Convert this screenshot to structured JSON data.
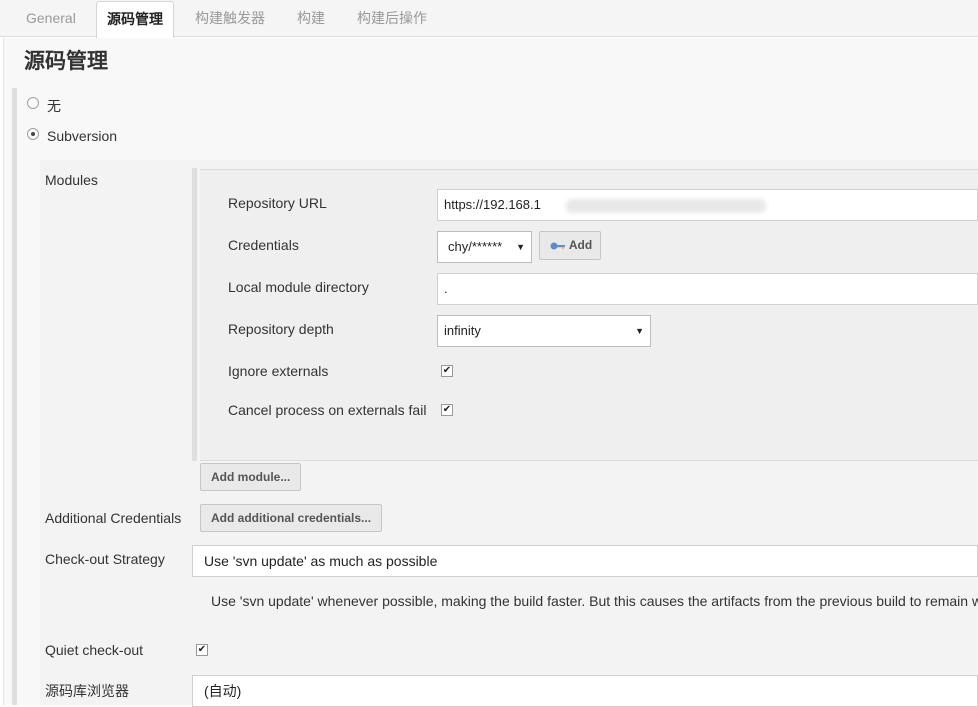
{
  "tabs": [
    {
      "label": "General"
    },
    {
      "label": "源码管理"
    },
    {
      "label": "构建触发器"
    },
    {
      "label": "构建"
    },
    {
      "label": "构建后操作"
    }
  ],
  "section_title": "源码管理",
  "scm_options": {
    "none_label": "无",
    "svn_label": "Subversion",
    "selected": "Subversion"
  },
  "modules": {
    "label": "Modules",
    "repository_url_label": "Repository URL",
    "repository_url_value": "https://192.168.1",
    "credentials_label": "Credentials",
    "credentials_value": "chy/******",
    "credentials_add_label": "Add",
    "local_dir_label": "Local module directory",
    "local_dir_value": ".",
    "depth_label": "Repository depth",
    "depth_value": "infinity",
    "ignore_externals_label": "Ignore externals",
    "ignore_externals_checked": true,
    "cancel_externals_label": "Cancel process on externals fail",
    "cancel_externals_checked": true,
    "add_module_label": "Add module..."
  },
  "additional_credentials": {
    "label": "Additional Credentials",
    "button_label": "Add additional credentials..."
  },
  "checkout_strategy": {
    "label": "Check-out Strategy",
    "value": "Use 'svn update' as much as possible",
    "help": "Use 'svn update' whenever possible, making the build faster. But this causes the artifacts from the previous build to remain w"
  },
  "quiet_checkout": {
    "label": "Quiet check-out",
    "checked": true
  },
  "repo_browser": {
    "label": "源码库浏览器",
    "value": "(自动)"
  },
  "check_glyph": "✔",
  "colors": {
    "key_icon": "#5b8dc9",
    "key_icon_accent": "#e0b030"
  }
}
